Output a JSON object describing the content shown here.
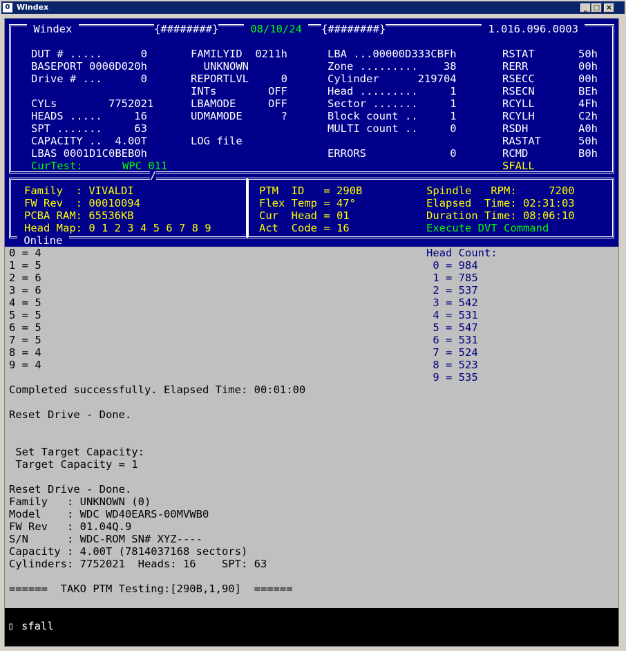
{
  "window": {
    "title": "Windex",
    "app_icon": "0",
    "minimize": "_",
    "maximize": "□",
    "close": "×"
  },
  "header": {
    "app": "Windex",
    "left_hash": "{########}",
    "date": "08/10/24",
    "right_hash": "{########}",
    "version": "1.016.096.0003"
  },
  "drive": {
    "col1": [
      "DUT # .....      0",
      "BASEPORT 0000D020h",
      "Drive # ...      0",
      "",
      "CYLs        7752021",
      "HEADS .....     16",
      "SPT .......     63",
      "CAPACITY ..  4.00T",
      "LBAS 0001D1C0BEB0h"
    ],
    "col2": [
      "FAMILYID  0211h",
      "  UNKNOWN",
      "REPORTLVL     0",
      "INTs        OFF",
      "LBAMODE     OFF",
      "UDMAMODE      ?",
      "",
      "LOG file"
    ],
    "col3": [
      "LBA ...00000D333CBFh",
      "Zone .........    38",
      "Cylinder      219704",
      "Head .........     1",
      "Sector .......     1",
      "Block count ..     1",
      "MULTI count ..     0",
      "",
      "ERRORS             0"
    ],
    "col4": [
      "RSTAT",
      "RERR",
      "RSECC",
      "RSECN",
      "RCYLL",
      "RCYLH",
      "RSDH",
      "RASTAT",
      "RCMD",
      "SFALL"
    ],
    "col5": [
      "50h",
      "00h",
      "00h",
      "BEh",
      "4Fh",
      "C2h",
      "A0h",
      "50h",
      "B0h",
      ""
    ],
    "curtest_label": "CurTest:",
    "curtest_value": "WPC 011"
  },
  "family_panel": {
    "lines": [
      "Family  : VIVALDI",
      "FW Rev  : 00010094",
      "PCBA RAM: 65536KB",
      "Head Map: 0 1 2 3 4 5 6 7 8 9"
    ]
  },
  "ptm_panel": {
    "lines": [
      "PTM  ID   = 290B",
      "Flex Temp = 47°",
      "Cur  Head = 01",
      "Act  Code = 16"
    ],
    "right_lines": [
      "Spindle   RPM:     7200",
      "Elapsed  Time: 02:31:03",
      "Duration Time: 08:06:10"
    ],
    "execute": "Execute DVT Command"
  },
  "online_label": "Online",
  "separator": "/",
  "log": {
    "head_map_lines": [
      "0 = 4",
      "1 = 5",
      "2 = 6",
      "3 = 6",
      "4 = 5",
      "5 = 5",
      "6 = 5",
      "7 = 5",
      "8 = 4",
      "9 = 4"
    ],
    "head_count_title": "Head Count:",
    "head_count_lines": [
      " 0 = 984",
      " 1 = 785",
      " 2 = 537",
      " 3 = 542",
      " 4 = 531",
      " 5 = 547",
      " 6 = 531",
      " 7 = 524",
      " 8 = 523",
      " 9 = 535"
    ],
    "lines": [
      "Completed successfully. Elapsed Time: 00:01:00",
      "",
      "Reset Drive - Done.",
      "",
      "",
      " Set Target Capacity:",
      " Target Capacity = 1",
      "",
      "Reset Drive - Done.",
      "Family   : UNKNOWN (0)",
      "Model    : WDC WD40EARS-00MVWB0",
      "FW Rev   : 01.04Q.9",
      "S/N      : WDC-ROM SN# XYZ----",
      "Capacity : 4.00T (7814037168 sectors)",
      "Cylinders: 7752021  Heads: 16    SPT: 63",
      "",
      "======  TAKO PTM Testing:[290B,1,90]  ======"
    ]
  },
  "command": {
    "cursor": "▯",
    "value": "sfall"
  }
}
